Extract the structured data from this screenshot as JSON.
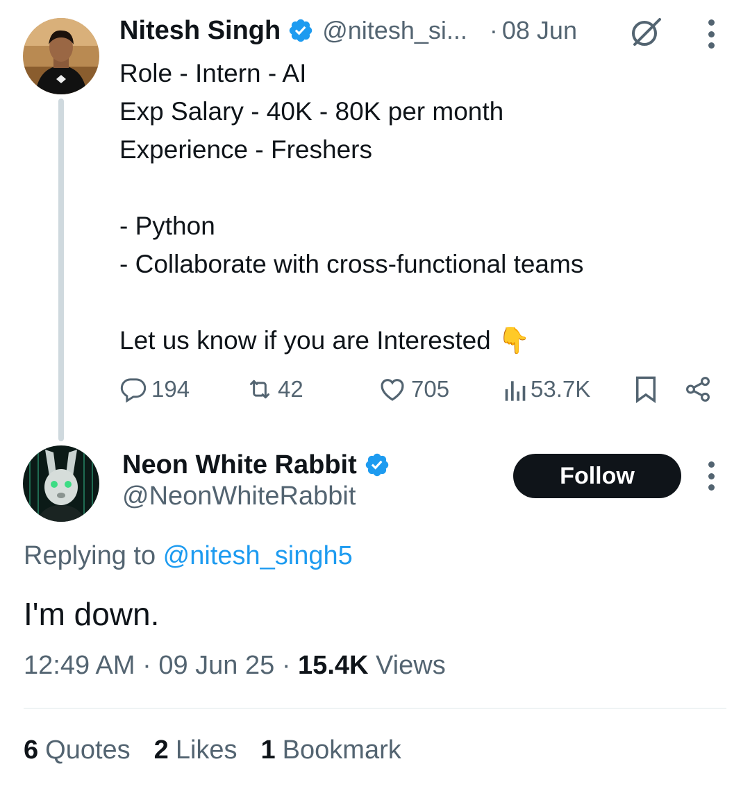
{
  "parent_tweet": {
    "author_name": "Nitesh Singh",
    "handle": "@nitesh_si...",
    "dot": "·",
    "date": "08 Jun",
    "lines": [
      "Role - Intern - AI",
      "Exp Salary - 40K - 80K per month",
      "Experience - Freshers",
      "",
      "- Python",
      "- Collaborate with cross-functional teams",
      "",
      "Let us know if you are Interested 👇"
    ],
    "metrics": {
      "replies": "194",
      "reposts": "42",
      "likes": "705",
      "views": "53.7K"
    }
  },
  "reply": {
    "author_name": "Neon White Rabbit",
    "handle": "@NeonWhiteRabbit",
    "follow_label": "Follow",
    "replying_prefix": "Replying to ",
    "replying_to": "@nitesh_singh5",
    "text": "I'm down.",
    "time": "12:49 AM",
    "sep1": " · ",
    "date": "09 Jun 25",
    "sep2": " · ",
    "views_count": "15.4K",
    "views_label": " Views",
    "stats": [
      {
        "count": "6",
        "label": "Quotes"
      },
      {
        "count": "2",
        "label": "Likes"
      },
      {
        "count": "1",
        "label": "Bookmark"
      }
    ]
  },
  "colors": {
    "verified_blue": "#1d9bf0",
    "text_primary": "#0f1419",
    "text_secondary": "#536471",
    "follow_bg": "#0f1419"
  },
  "icons": [
    "verified-badge-icon",
    "grok-icon",
    "more-icon",
    "reply-icon",
    "repost-icon",
    "like-icon",
    "views-icon",
    "bookmark-icon",
    "share-icon"
  ]
}
